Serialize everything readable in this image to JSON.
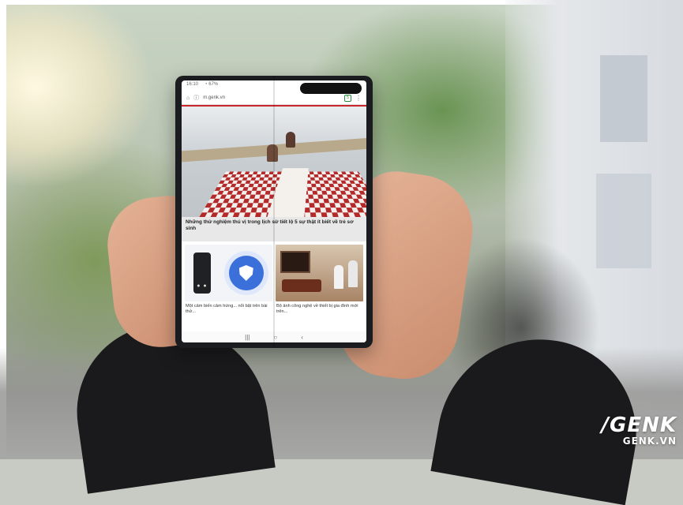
{
  "browser": {
    "status_time": "16:10",
    "status_right": "◔ 67%",
    "url": "m.genk.vn",
    "tabs_count": "5"
  },
  "article": {
    "headline": "Những thử nghiệm thú vị trong lịch sử tiết lộ 5 sự thật ít biết về trẻ sơ sinh"
  },
  "cards": [
    {
      "caption": "Một cảm biến cảm hứng... nổi bật trên bài thử..."
    },
    {
      "caption": "Bộ ảnh công nghệ về thiết bị gia đình mới trên..."
    }
  ],
  "watermark": {
    "mark": "/GENK",
    "sub": "GENK.VN"
  },
  "colors": {
    "accent_red": "#c9262c",
    "shield_blue": "#3b6fd9"
  }
}
